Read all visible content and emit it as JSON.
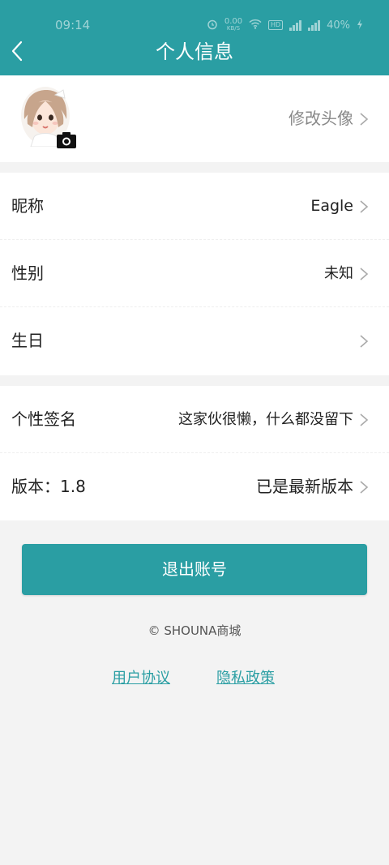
{
  "statusbar": {
    "time": "09:14",
    "speed_value": "0.00",
    "speed_unit": "KB/S",
    "hd_badge": "HD",
    "battery": "40%"
  },
  "header": {
    "title": "个人信息",
    "back_icon": "chevron-left-icon"
  },
  "avatar": {
    "change_label": "修改头像",
    "camera_icon": "camera-icon"
  },
  "profile": {
    "nickname_label": "昵称",
    "nickname_value": "Eagle",
    "gender_label": "性别",
    "gender_value": "未知",
    "birthday_label": "生日"
  },
  "misc": {
    "signature_label": "个性签名",
    "signature_value": "这家伙很懒，什么都没留下",
    "version_label": "版本：1.8",
    "version_status": "已是最新版本"
  },
  "actions": {
    "logout_label": "退出账号"
  },
  "footer": {
    "copyright": "© SHOUNA商城",
    "user_agreement": "用户协议",
    "privacy_policy": "隐私政策"
  },
  "colors": {
    "brand": "#2a9ea3",
    "background": "#f3f3f3"
  }
}
